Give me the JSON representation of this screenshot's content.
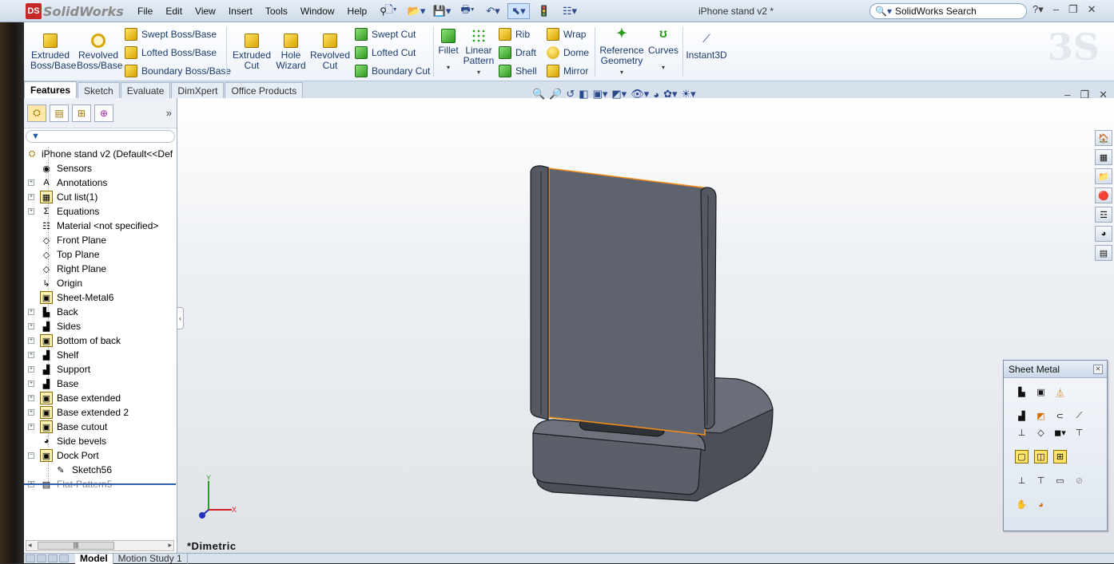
{
  "app": {
    "logo_text": "SolidWorks",
    "logo_mark": "DS"
  },
  "menus": [
    "File",
    "Edit",
    "View",
    "Insert",
    "Tools",
    "Window",
    "Help"
  ],
  "document_title": "iPhone stand v2 *",
  "search": {
    "placeholder": "SolidWorks Search"
  },
  "commands": {
    "extruded_boss": "Extruded Boss/Base",
    "revolved_boss": "Revolved Boss/Base",
    "swept_boss": "Swept Boss/Base",
    "lofted_boss": "Lofted Boss/Base",
    "boundary_boss": "Boundary Boss/Base",
    "extruded_cut": "Extruded Cut",
    "hole_wizard": "Hole Wizard",
    "revolved_cut": "Revolved Cut",
    "swept_cut": "Swept Cut",
    "lofted_cut": "Lofted Cut",
    "boundary_cut": "Boundary Cut",
    "fillet": "Fillet",
    "linear_pattern": "Linear Pattern",
    "rib": "Rib",
    "draft": "Draft",
    "shell": "Shell",
    "wrap": "Wrap",
    "dome": "Dome",
    "mirror": "Mirror",
    "reference_geometry": "Reference Geometry",
    "curves": "Curves",
    "instant3d": "Instant3D"
  },
  "tabs": [
    "Features",
    "Sketch",
    "Evaluate",
    "DimXpert",
    "Office Products"
  ],
  "tree": {
    "root": "iPhone stand v2  (Default<<Def",
    "items": [
      {
        "label": "Sensors",
        "icon": "sensor-icon",
        "expandable": false
      },
      {
        "label": "Annotations",
        "icon": "annotations-icon",
        "expandable": true
      },
      {
        "label": "Cut list(1)",
        "icon": "cutlist-icon",
        "expandable": true
      },
      {
        "label": "Equations",
        "icon": "equations-icon",
        "expandable": true
      },
      {
        "label": "Material <not specified>",
        "icon": "material-icon",
        "expandable": false
      },
      {
        "label": "Front Plane",
        "icon": "plane-icon",
        "expandable": false
      },
      {
        "label": "Top Plane",
        "icon": "plane-icon",
        "expandable": false
      },
      {
        "label": "Right Plane",
        "icon": "plane-icon",
        "expandable": false
      },
      {
        "label": "Origin",
        "icon": "origin-icon",
        "expandable": false
      },
      {
        "label": "Sheet-Metal6",
        "icon": "sheet-metal-icon",
        "expandable": false
      },
      {
        "label": "Back",
        "icon": "base-flange-icon",
        "expandable": true
      },
      {
        "label": "Sides",
        "icon": "edge-flange-icon",
        "expandable": true
      },
      {
        "label": "Bottom of back",
        "icon": "extrude-icon",
        "expandable": true
      },
      {
        "label": "Shelf",
        "icon": "edge-flange-icon",
        "expandable": true
      },
      {
        "label": "Support",
        "icon": "edge-flange-icon",
        "expandable": true
      },
      {
        "label": "Base",
        "icon": "edge-flange-icon",
        "expandable": true
      },
      {
        "label": "Base extended",
        "icon": "extrude-icon",
        "expandable": true
      },
      {
        "label": "Base extended 2",
        "icon": "extrude-icon",
        "expandable": true
      },
      {
        "label": "Base cutout",
        "icon": "cut-icon",
        "expandable": true
      },
      {
        "label": "Side bevels",
        "icon": "fillet-icon",
        "expandable": false
      },
      {
        "label": "Dock Port",
        "icon": "cut-icon",
        "expandable": true,
        "expanded": true
      },
      {
        "label": "Sketch56",
        "icon": "sketch-icon",
        "child": true
      },
      {
        "label": "Flat-Pattern5",
        "icon": "flat-pattern-icon",
        "expandable": true,
        "suppressed": true
      }
    ]
  },
  "viewport": {
    "view_label": "*Dimetric",
    "axis_x": "X",
    "axis_y": "Y"
  },
  "sheet_metal": {
    "title": "Sheet Metal"
  },
  "bottom_tabs": [
    "Model",
    "Motion Study 1"
  ],
  "colors": {
    "selection": "#f08c1c",
    "model": "#5e636e",
    "accent": "#2b4a8a"
  }
}
